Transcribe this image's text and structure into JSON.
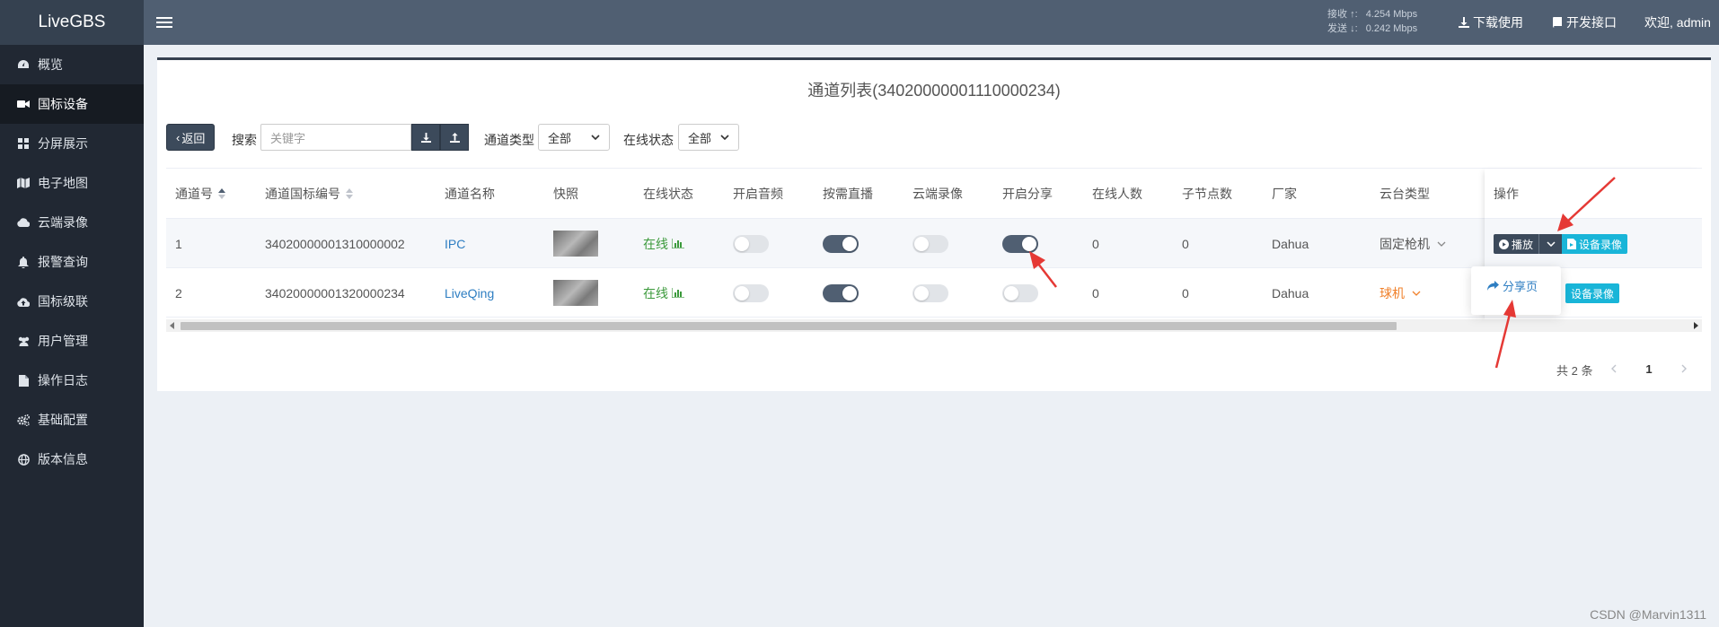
{
  "app": {
    "title": "LiveGBS"
  },
  "header": {
    "net": {
      "recv_label": "接收",
      "recv_value": "4.254 Mbps",
      "send_label": "发送",
      "send_value": "0.242 Mbps"
    },
    "download": "下载使用",
    "api": "开发接口",
    "welcome": "欢迎, admin"
  },
  "sidebar": {
    "items": [
      {
        "label": "概览",
        "icon": "dashboard-icon"
      },
      {
        "label": "国标设备",
        "icon": "video-camera-icon",
        "active": true
      },
      {
        "label": "分屏展示",
        "icon": "grid-icon"
      },
      {
        "label": "电子地图",
        "icon": "map-icon"
      },
      {
        "label": "云端录像",
        "icon": "cloud-icon"
      },
      {
        "label": "报警查询",
        "icon": "bell-icon"
      },
      {
        "label": "国标级联",
        "icon": "cloud-upload-icon"
      },
      {
        "label": "用户管理",
        "icon": "users-icon"
      },
      {
        "label": "操作日志",
        "icon": "file-icon"
      },
      {
        "label": "基础配置",
        "icon": "gears-icon"
      },
      {
        "label": "版本信息",
        "icon": "globe-icon"
      }
    ]
  },
  "main": {
    "title": "通道列表(34020000001110000234)",
    "back": "返回",
    "search_label": "搜索",
    "search_placeholder": "关键字",
    "channel_type_label": "通道类型",
    "channel_type_value": "全部",
    "status_label": "在线状态",
    "status_value": "全部",
    "columns": [
      "通道号",
      "通道国标编号",
      "通道名称",
      "快照",
      "在线状态",
      "开启音频",
      "按需直播",
      "云端录像",
      "开启分享",
      "在线人数",
      "子节点数",
      "厂家",
      "云台类型",
      "操作"
    ],
    "rows": [
      {
        "no": "1",
        "gbid": "34020000001310000002",
        "name": "IPC",
        "status": "在线",
        "audio": false,
        "ondemand": true,
        "cloud": false,
        "share": true,
        "online": "0",
        "children": "0",
        "vendor": "Dahua",
        "ptz": "固定枪机"
      },
      {
        "no": "2",
        "gbid": "34020000001320000234",
        "name": "LiveQing",
        "status": "在线",
        "audio": false,
        "ondemand": true,
        "cloud": false,
        "share": false,
        "online": "0",
        "children": "0",
        "vendor": "Dahua",
        "ptz": "球机"
      }
    ],
    "ops": {
      "play": "播放",
      "record": "设备录像",
      "share_page": "分享页"
    },
    "pager": {
      "total": "共 2 条",
      "current": "1"
    }
  },
  "colors": {
    "accent": "#505f72",
    "sidebar": "#212833",
    "link": "#2e7ec2",
    "online": "#3c9a3c",
    "record_btn": "#19b5d8",
    "annotation_arrow": "#e53935"
  },
  "watermark": "CSDN @Marvin1311"
}
